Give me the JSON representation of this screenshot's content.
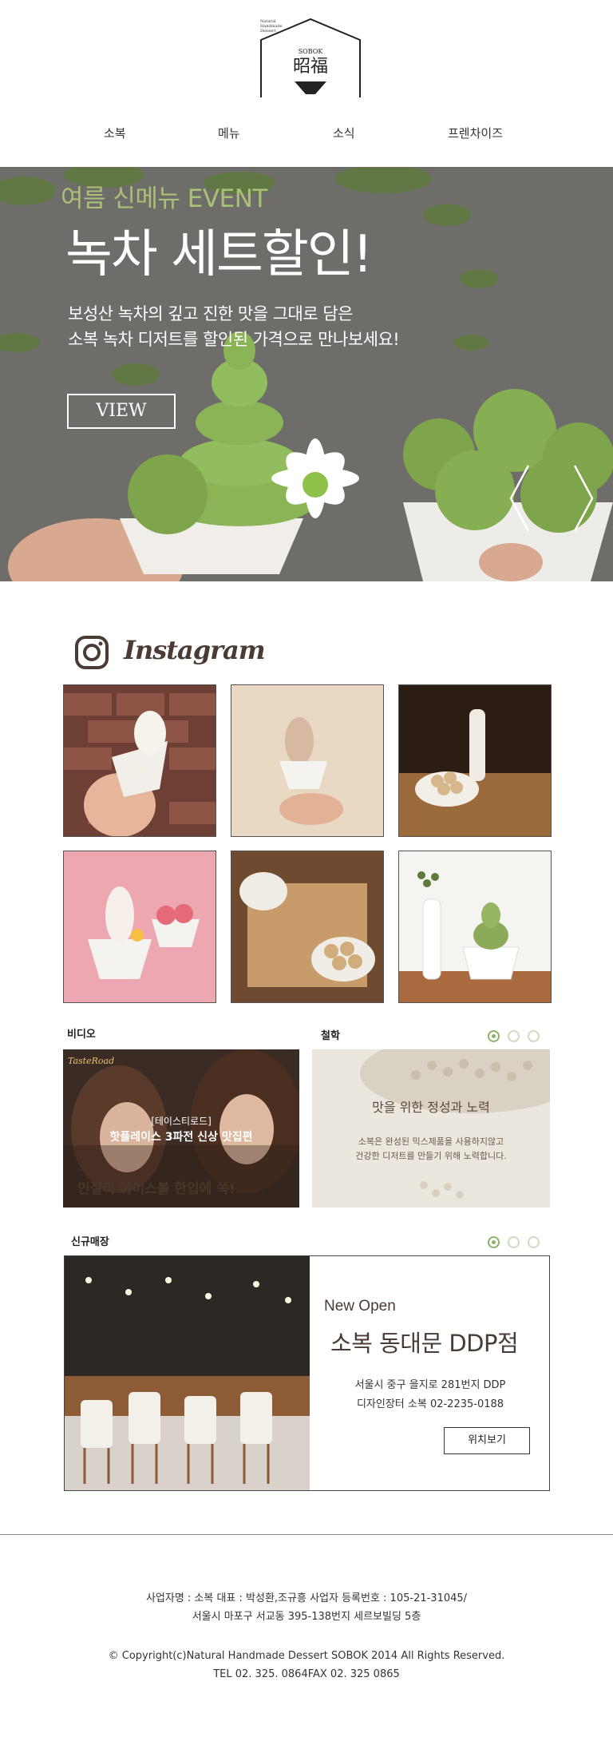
{
  "logo": {
    "small_lines": [
      "Natural",
      "Handmade",
      "Dessert"
    ],
    "brand_en": "SOBOK",
    "brand_hanja": "昭福"
  },
  "nav": {
    "items": [
      "소복",
      "메뉴",
      "소식",
      "프렌차이즈"
    ]
  },
  "hero": {
    "event": "여름 신메뉴 EVENT",
    "title": "녹차 세트할인!",
    "desc_line1": "보성산 녹차의 깊고 진한 맛을 그대로 담은",
    "desc_line2": "소복 녹차 디저트를 할인된 가격으로 만나보세요!",
    "view_label": "VIEW"
  },
  "instagram": {
    "title": "Instagram"
  },
  "video": {
    "label": "비디오",
    "logo": "TasteRoad",
    "subtitle": "[테이스티로드]",
    "title": "핫플레이스 3파전 신상 맛집편",
    "overlay": "인절미 아이스볼 한입에 쏙!"
  },
  "philosophy": {
    "label": "철학",
    "title": "맛을 위한 정성과 노력",
    "desc_line1": "소복은 완성된 믹스제품을 사용하지않고",
    "desc_line2": "건강한 디저트를 만들기 위해 노력합니다."
  },
  "store": {
    "label": "신규매장",
    "new_open": "New Open",
    "name": "소복 동대문 DDP점",
    "addr_line1": "서울시 중구 을지로 281번지 DDP",
    "addr_line2": "디자인장터 소복 02-2235-0188",
    "button": "위치보기"
  },
  "footer": {
    "line1": "사업자명 : 소복 대표 : 박성환,조규흥 사업자 등록번호 : 105-21-31045/",
    "line2": "서울시 마포구 서교동 395-138번지 세르보빌딩 5층",
    "line3": "© Copyright(c)Natural Handmade Dessert SOBOK 2014 All Rights Reserved.",
    "line4": "TEL 02. 325. 0864FAX 02. 325 0865"
  },
  "colors": {
    "accent_green": "#8db36a",
    "brand_brown": "#4a3c35"
  }
}
